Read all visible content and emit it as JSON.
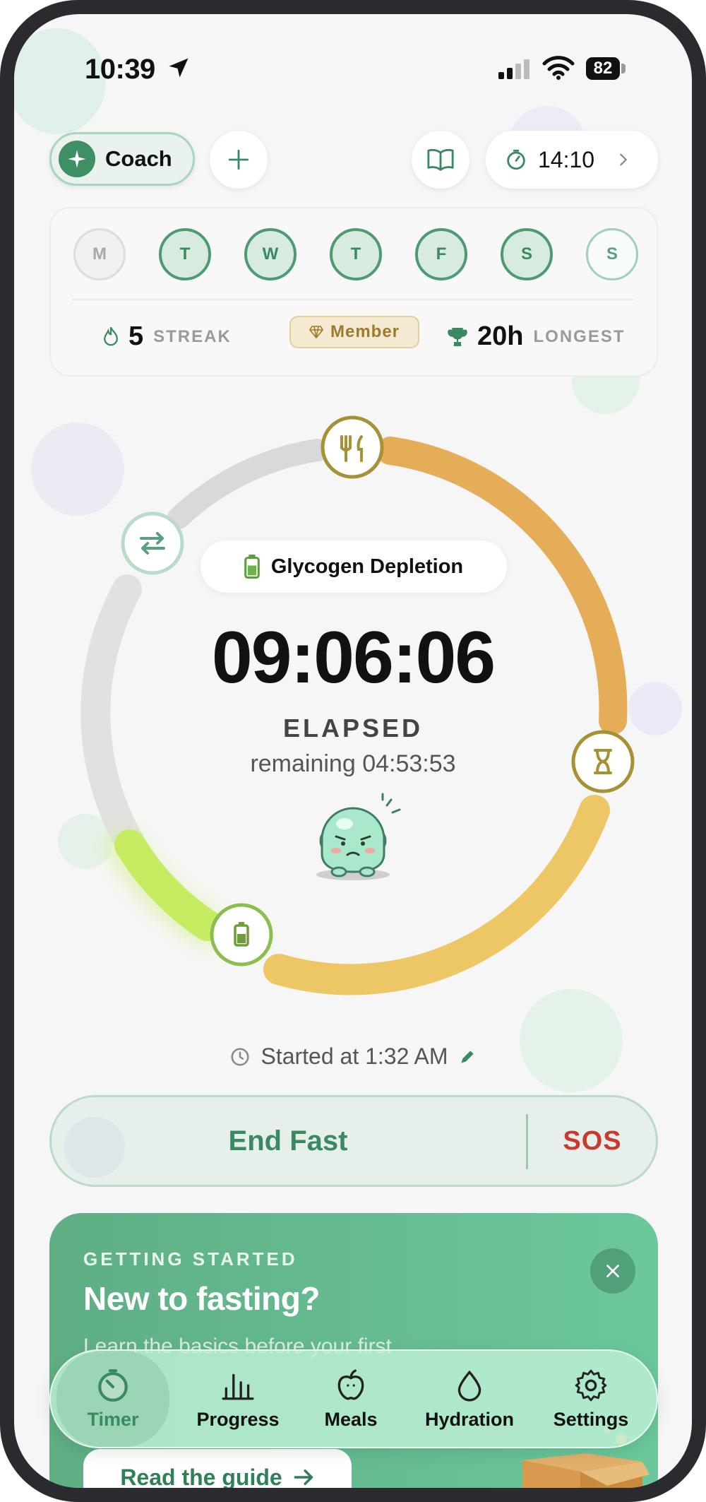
{
  "status_bar": {
    "time": "10:39",
    "battery": "82",
    "icons": [
      "location-arrow-icon",
      "cellular-signal-icon",
      "wifi-icon",
      "battery-icon"
    ]
  },
  "header": {
    "coach_label": "Coach",
    "timer_value": "14:10",
    "icons": [
      "sparkle-icon",
      "plus-icon",
      "book-icon",
      "stopwatch-icon",
      "chevron-right-icon"
    ]
  },
  "week": {
    "days": [
      {
        "letter": "M",
        "state": "off"
      },
      {
        "letter": "T",
        "state": "done"
      },
      {
        "letter": "W",
        "state": "done"
      },
      {
        "letter": "T",
        "state": "done"
      },
      {
        "letter": "F",
        "state": "done"
      },
      {
        "letter": "S",
        "state": "done"
      },
      {
        "letter": "S",
        "state": "next"
      }
    ],
    "streak_value": "5",
    "streak_label": "STREAK",
    "member_label": "Member",
    "longest_value": "20h",
    "longest_label": "LONGEST"
  },
  "timer": {
    "phase_label": "Glycogen Depletion",
    "elapsed": "09:06:06",
    "elapsed_label": "ELAPSED",
    "remaining": "remaining 04:53:53",
    "progress": 0.655,
    "started_text": "Started at 1:32 AM"
  },
  "actions": {
    "end_label": "End Fast",
    "sos_label": "SOS"
  },
  "banner": {
    "kicker": "GETTING STARTED",
    "title": "New to fasting?",
    "body": "Learn the basics before your first",
    "button_label": "Read the guide"
  },
  "tabs": [
    {
      "label": "Timer",
      "icon": "timer-icon",
      "active": true
    },
    {
      "label": "Progress",
      "icon": "bar-chart-icon",
      "active": false
    },
    {
      "label": "Meals",
      "icon": "apple-icon",
      "active": false
    },
    {
      "label": "Hydration",
      "icon": "water-drop-icon",
      "active": false
    },
    {
      "label": "Settings",
      "icon": "gear-icon",
      "active": false
    }
  ],
  "colors": {
    "accent_green": "#3a8a61",
    "ring_orange": "#e6ad58",
    "ring_yellow": "#edc765",
    "ring_lime": "#c6ec62",
    "ring_gray": "#e1e1e1",
    "sos_red": "#c8392e"
  }
}
